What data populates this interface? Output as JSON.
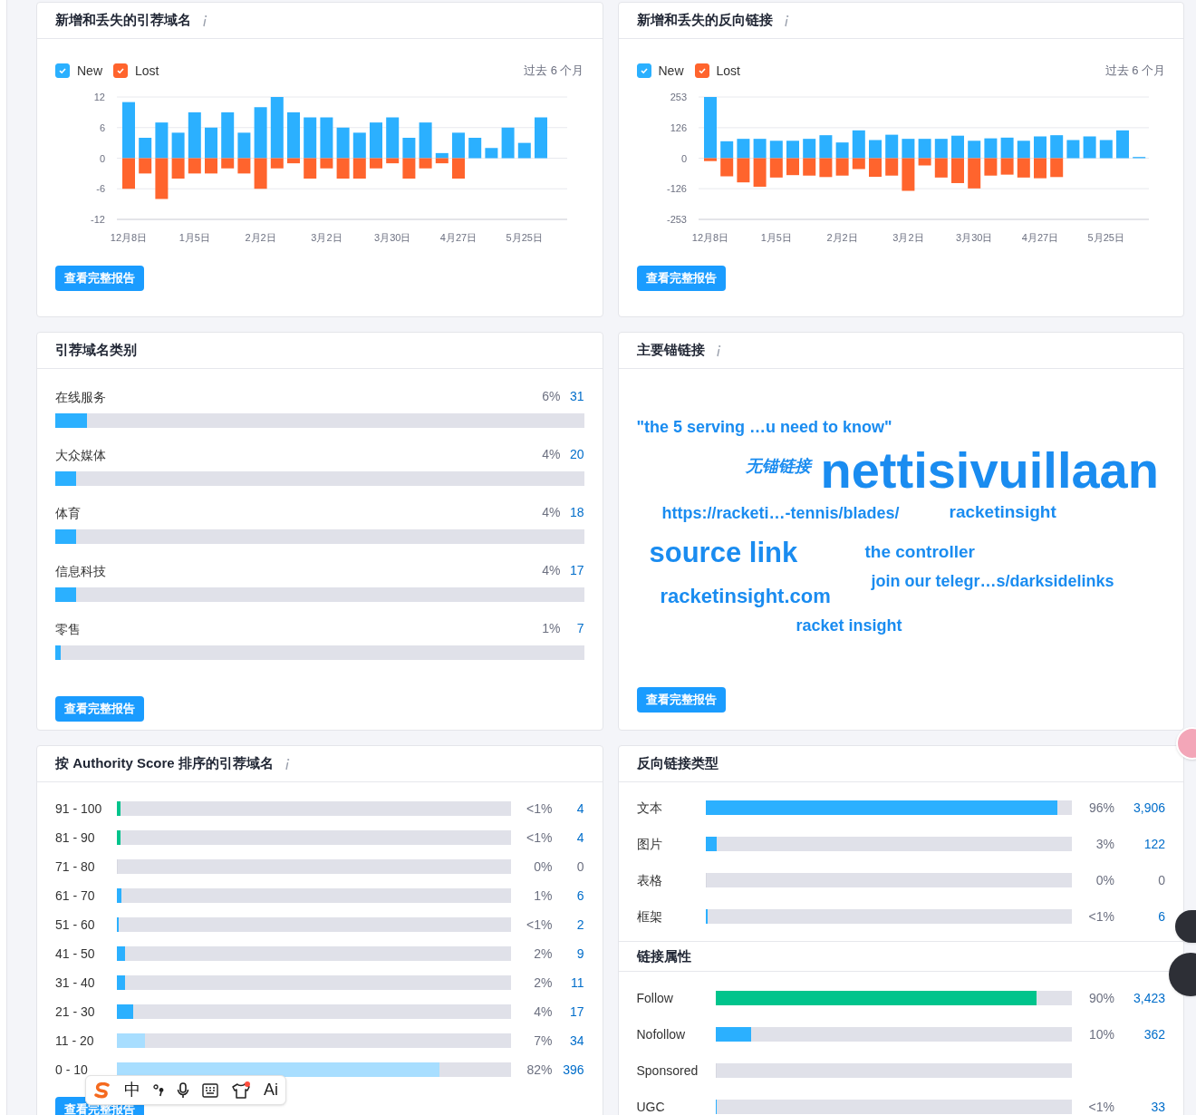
{
  "new_lost_domains": {
    "title": "新增和丢失的引荐域名",
    "legend": [
      {
        "checked": true
      },
      {
        "checked": true
      }
    ],
    "period": "过去 6 个月",
    "chart_data": {
      "type": "bar",
      "stacked": true,
      "categories": [
        "12月8日",
        null,
        null,
        null,
        "1月5日",
        null,
        null,
        null,
        "2月2日",
        null,
        null,
        null,
        "3月2日",
        null,
        null,
        null,
        "3月30日",
        null,
        null,
        null,
        "4月27日",
        null,
        null,
        null,
        "5月25日",
        null,
        null
      ],
      "series": [
        {
          "name": "New",
          "color": "#2bb0ff",
          "values": [
            11,
            4,
            7,
            5,
            9,
            6,
            9,
            5,
            10,
            12,
            9,
            8,
            8,
            6,
            5,
            7,
            8,
            4,
            7,
            1,
            5,
            4,
            2,
            6,
            3,
            8,
            0
          ]
        },
        {
          "name": "Lost",
          "color": "#ff642d",
          "values": [
            -6,
            -3,
            -8,
            -4,
            -3,
            -3,
            -2,
            -3,
            -6,
            -2,
            -1,
            -4,
            -2,
            -4,
            -4,
            -2,
            -1,
            -4,
            -2,
            -1,
            -4,
            0,
            0,
            0,
            0,
            0,
            0
          ]
        }
      ],
      "ylim": [
        -12,
        12
      ],
      "yticks": [
        12,
        6,
        0,
        -6,
        -12
      ],
      "grid": true
    },
    "button": "查看完整报告"
  },
  "new_lost_backlinks": {
    "title": "新增和丢失的反向链接",
    "legend": [
      {
        "checked": true
      },
      {
        "checked": true
      }
    ],
    "period": "过去 6 个月",
    "chart_data": {
      "type": "bar",
      "stacked": true,
      "categories": [
        "12月8日",
        null,
        null,
        null,
        "1月5日",
        null,
        null,
        null,
        "2月2日",
        null,
        null,
        null,
        "3月2日",
        null,
        null,
        null,
        "3月30日",
        null,
        null,
        null,
        "4月27日",
        null,
        null,
        null,
        "5月25日",
        null,
        null
      ],
      "series": [
        {
          "name": "New",
          "color": "#2bb0ff",
          "values": [
            253,
            70,
            80,
            80,
            72,
            72,
            80,
            95,
            65,
            115,
            75,
            97,
            80,
            80,
            80,
            93,
            72,
            82,
            85,
            72,
            90,
            95,
            75,
            90,
            75,
            115,
            5
          ]
        },
        {
          "name": "Lost",
          "color": "#ff642d",
          "values": [
            -12,
            -75,
            -100,
            -118,
            -80,
            -70,
            -72,
            -78,
            -72,
            -45,
            -77,
            -72,
            -135,
            -30,
            -80,
            -103,
            -125,
            -72,
            -68,
            -80,
            -83,
            -78,
            0,
            0,
            0,
            0,
            0
          ]
        }
      ],
      "ylim": [
        -253,
        253
      ],
      "yticks": [
        253,
        126,
        0,
        -126,
        -253
      ],
      "grid": true
    },
    "button": "查看完整报告"
  },
  "domain_categories": {
    "title": "引荐域名类别",
    "rows": [
      {
        "label": "在线服务",
        "percent": "6%",
        "count": "31",
        "level": 0.06
      },
      {
        "label": "大众媒体",
        "percent": "4%",
        "count": "20",
        "level": 0.04
      },
      {
        "label": "体育",
        "percent": "4%",
        "count": "18",
        "level": 0.04
      },
      {
        "label": "信息科技",
        "percent": "4%",
        "count": "17",
        "level": 0.04
      },
      {
        "label": "零售",
        "percent": "1%",
        "count": "7",
        "level": 0.01
      }
    ],
    "button": "查看完整报告"
  },
  "top_anchors": {
    "title": "主要锚链接",
    "words": [
      {
        "text": "\"the 5 serving …u need to know\"",
        "kind": "anchor"
      },
      {
        "text": "无锚链接",
        "kind": "no_anchor"
      },
      {
        "text": "nettisivuillaan",
        "kind": "anchor"
      },
      {
        "text": "https://racketi…-tennis/blades/",
        "kind": "anchor"
      },
      {
        "text": "racketinsight",
        "kind": "anchor"
      },
      {
        "text": "source link",
        "kind": "anchor"
      },
      {
        "text": "the controller",
        "kind": "anchor"
      },
      {
        "text": "join our telegr…s/darksidelinks",
        "kind": "anchor"
      },
      {
        "text": "racketinsight.com",
        "kind": "anchor"
      },
      {
        "text": "racket insight",
        "kind": "anchor"
      }
    ],
    "button": "查看完整报告"
  },
  "authority_score": {
    "title": "按 Authority Score 排序的引荐域名",
    "rows": [
      {
        "label": "91 - 100",
        "percent": "<1%",
        "count": "4",
        "level": 0.01,
        "color": "#00c48c"
      },
      {
        "label": "81 - 90",
        "percent": "<1%",
        "count": "4",
        "level": 0.01,
        "color": "#00c48c"
      },
      {
        "label": "71 - 80",
        "percent": "0%",
        "count": "0",
        "level": 0
      },
      {
        "label": "61 - 70",
        "percent": "1%",
        "count": "6",
        "level": 0.012,
        "color": "#2bb0ff"
      },
      {
        "label": "51 - 60",
        "percent": "<1%",
        "count": "2",
        "level": 0.004,
        "color": "#2bb0ff"
      },
      {
        "label": "41 - 50",
        "percent": "2%",
        "count": "9",
        "level": 0.02,
        "color": "#2bb0ff"
      },
      {
        "label": "31 - 40",
        "percent": "2%",
        "count": "11",
        "level": 0.02,
        "color": "#2bb0ff"
      },
      {
        "label": "21 - 30",
        "percent": "4%",
        "count": "17",
        "level": 0.041,
        "color": "#2bb0ff"
      },
      {
        "label": "11 - 20",
        "percent": "7%",
        "count": "34",
        "level": 0.071,
        "color": "#a8deff"
      },
      {
        "label": "0 - 10",
        "percent": "82%",
        "count": "396",
        "level": 0.82,
        "color": "#a8deff"
      }
    ],
    "button": "查看完整报告"
  },
  "backlink_types": {
    "title": "反向链接类型",
    "rows": [
      {
        "label": "文本",
        "percent": "96%",
        "count": "3,906",
        "level": 0.96
      },
      {
        "label": "图片",
        "percent": "3%",
        "count": "122",
        "level": 0.03
      },
      {
        "label": "表格",
        "percent": "0%",
        "count": "0",
        "level": 0
      },
      {
        "label": "框架",
        "percent": "<1%",
        "count": "6",
        "level": 0.005
      }
    ]
  },
  "link_attributes": {
    "title": "链接属性",
    "rows": [
      {
        "label": "Follow",
        "percent": "90%",
        "count": "3,423",
        "level": 0.9,
        "color": "#00c48c"
      },
      {
        "label": "Nofollow",
        "percent": "10%",
        "count": "362",
        "level": 0.1,
        "color": "#2bb0ff"
      },
      {
        "label": "Sponsored",
        "level": 0
      },
      {
        "label": "UGC",
        "percent": "<1%",
        "count": "33",
        "level": 0.005,
        "color": "#2bb0ff"
      }
    ]
  },
  "input_method_toolbar": {
    "items": [
      {
        "kind": "logo"
      },
      {
        "kind": "text",
        "text": "中"
      },
      {
        "kind": "punct"
      },
      {
        "kind": "mic"
      },
      {
        "kind": "keyboard"
      },
      {
        "kind": "skin"
      },
      {
        "kind": "text",
        "text": "Ai"
      }
    ]
  }
}
